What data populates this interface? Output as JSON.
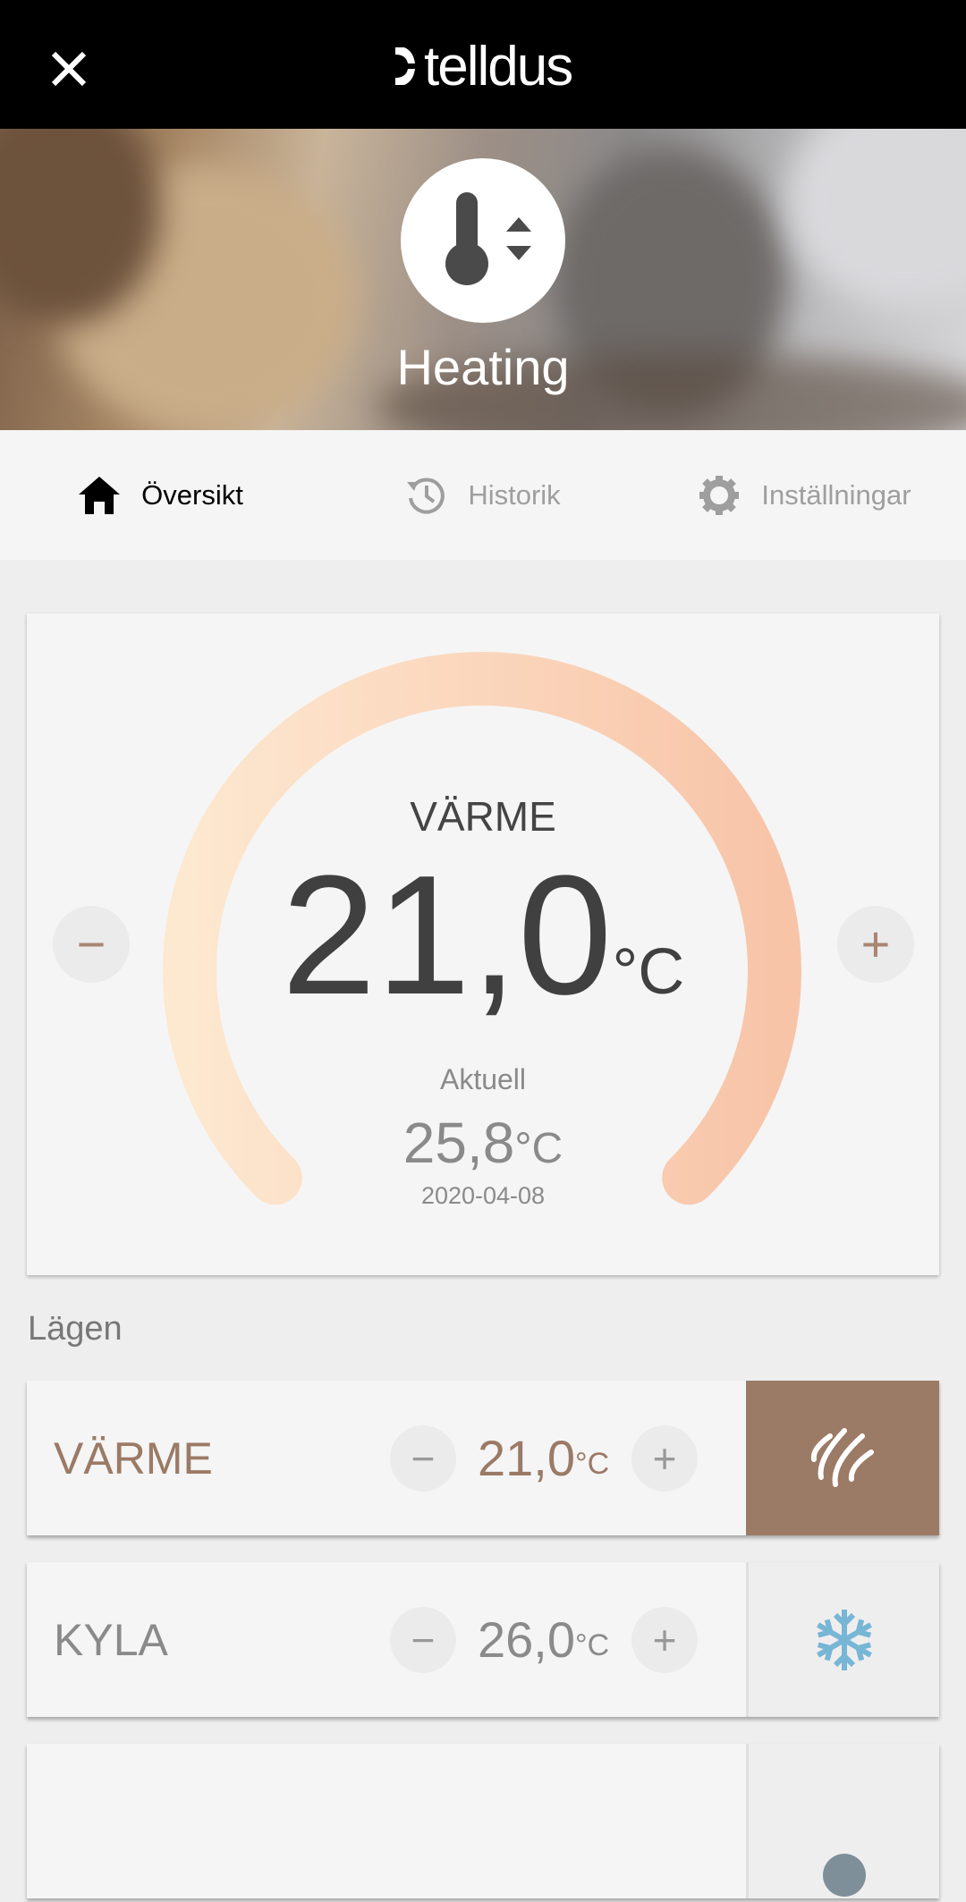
{
  "header": {
    "brand": "telldus",
    "close_icon": "close-icon"
  },
  "hero": {
    "title": "Heating",
    "icon": "thermostat-icon"
  },
  "tabs": [
    {
      "label": "Översikt",
      "icon": "home-icon",
      "active": true
    },
    {
      "label": "Historik",
      "icon": "history-icon",
      "active": false
    },
    {
      "label": "Inställningar",
      "icon": "gear-icon",
      "active": false
    }
  ],
  "gauge": {
    "mode": "VÄRME",
    "setpoint": "21,0",
    "unit": "°C",
    "current_label": "Aktuell",
    "current": "25,8",
    "current_unit": "°C",
    "date": "2020-04-08",
    "decrease": "−",
    "increase": "+"
  },
  "modes_title": "Lägen",
  "modes": [
    {
      "name": "VÄRME",
      "value": "21,0",
      "unit": "°C",
      "minus": "−",
      "plus": "+",
      "icon": "heat-icon",
      "active": true
    },
    {
      "name": "KYLA",
      "value": "26,0",
      "unit": "°C",
      "minus": "−",
      "plus": "+",
      "icon": "snowflake-icon",
      "active": false
    }
  ],
  "colors": {
    "accent": "#9b7a66",
    "cool": "#78b6d6",
    "gauge_start": "#fde6cc",
    "gauge_end": "#f8c5ab"
  }
}
